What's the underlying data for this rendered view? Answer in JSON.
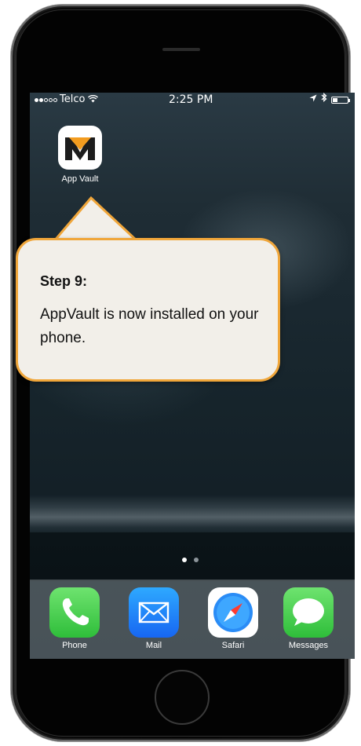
{
  "statusbar": {
    "carrier": "Telco",
    "time": "2:25  PM",
    "signal_bars_filled": 2,
    "signal_bars_total": 5,
    "battery_level": 0.35
  },
  "home_app": {
    "label": "App Vault",
    "icon": "appvault-logo-icon",
    "brand_color": "#f39c1f"
  },
  "callout": {
    "title": "Step 9:",
    "body": "AppVault is now installed on your phone.",
    "border_color": "#f0a63a"
  },
  "page_indicator": {
    "pages": 2,
    "current": 0
  },
  "dock": {
    "apps": [
      {
        "label": "Phone",
        "icon": "phone-icon",
        "color": "#4cd964"
      },
      {
        "label": "Mail",
        "icon": "mail-icon",
        "color": "#1e8bff"
      },
      {
        "label": "Safari",
        "icon": "safari-compass-icon",
        "color": "#1a7ff5"
      },
      {
        "label": "Messages",
        "icon": "messages-icon",
        "color": "#4cd964"
      }
    ]
  }
}
